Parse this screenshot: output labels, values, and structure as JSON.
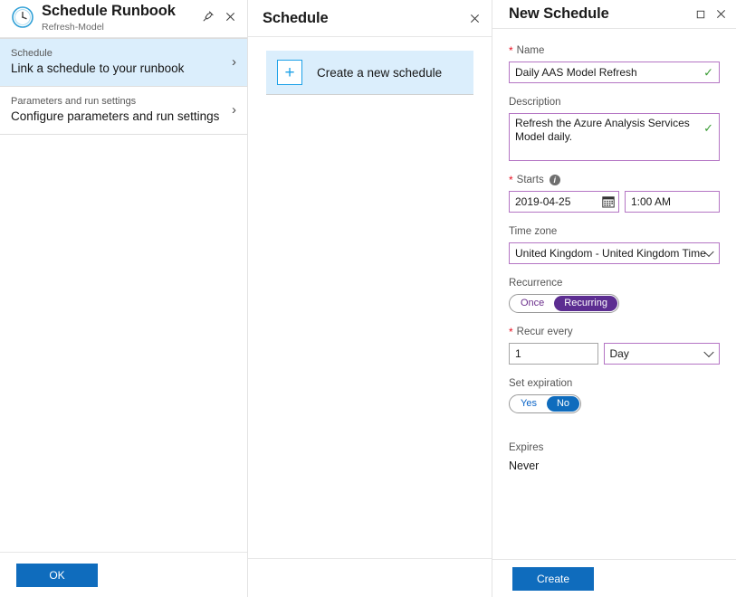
{
  "blade_runbook": {
    "title": "Schedule Runbook",
    "subtitle": "Refresh-Model",
    "pin_icon": "pin-icon",
    "close_icon": "close-icon",
    "nav_items": [
      {
        "label": "Schedule",
        "value": "Link a schedule to your runbook",
        "selected": true
      },
      {
        "label": "Parameters and run settings",
        "value": "Configure parameters and run settings",
        "selected": false
      }
    ],
    "chevron": "›",
    "ok_label": "OK"
  },
  "blade_schedule": {
    "title": "Schedule",
    "close_icon": "close-icon",
    "create_tile": {
      "plus": "+",
      "label": "Create a new schedule"
    }
  },
  "blade_new": {
    "title": "New Schedule",
    "maximize_icon": "maximize-icon",
    "close_icon": "close-icon",
    "fields": {
      "name": {
        "label": "Name",
        "required": true,
        "value": "Daily AAS Model Refresh",
        "placeholder": "",
        "valid_mark": "✓"
      },
      "description": {
        "label": "Description",
        "required": false,
        "value": "Refresh the Azure Analysis Services Model daily.",
        "placeholder": "",
        "valid_mark": "✓"
      },
      "starts": {
        "label": "Starts",
        "required": true,
        "info": "i",
        "date_value": "2019-04-25",
        "time_value": "1:00 AM"
      },
      "timezone": {
        "label": "Time zone",
        "value": "United Kingdom - United Kingdom Time"
      },
      "recurrence": {
        "label": "Recurrence",
        "options": [
          "Once",
          "Recurring"
        ],
        "selected": "Recurring"
      },
      "recur_every": {
        "label": "Recur every",
        "required": true,
        "count_value": "1",
        "unit_value": "Day"
      },
      "set_expiration": {
        "label": "Set expiration",
        "options": [
          "Yes",
          "No"
        ],
        "selected": "No"
      },
      "expires": {
        "label": "Expires",
        "value": "Never"
      }
    },
    "create_label": "Create"
  },
  "colors": {
    "accent_blue": "#0f6cbd",
    "selected_row": "#dbeefc",
    "validated_border": "#b475c4",
    "toggle_purple": "#5c2d91",
    "required_red": "#e81123",
    "check_green": "#3a9c35"
  }
}
